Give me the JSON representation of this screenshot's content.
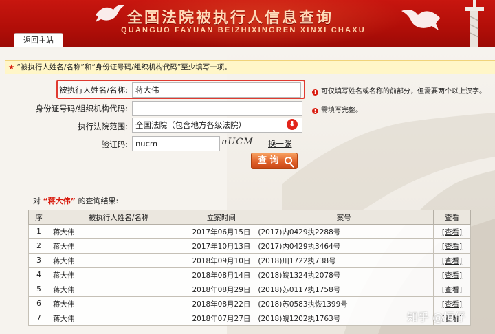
{
  "header": {
    "title_cn": "全国法院被执行人信息查询",
    "title_en": "QUANGUO FAYUAN BEIZHIXINGREN XINXI CHAXU",
    "home_tab_label": "返回主站"
  },
  "notice": {
    "text": "“被执行人姓名/名称”和“身份证号码/组织机构代码”至少填写一项。"
  },
  "form": {
    "name_label": "被执行人姓名/名称:",
    "name_value": "蒋大伟",
    "name_hint": "可仅填写姓名或名称的前部分，但需要两个以上汉字。",
    "id_label": "身份证号码/组织机构代码:",
    "id_value": "",
    "id_hint": "需填写完整。",
    "court_label": "执行法院范围:",
    "court_value": "全国法院（包含地方各级法院）",
    "captcha_label": "验证码:",
    "captcha_value": "nucm",
    "captcha_image_text": "nUCM",
    "refresh_label": "换一张",
    "query_label": "查 询"
  },
  "results": {
    "caption_prefix": "对",
    "caption_name": "“蒋大伟”",
    "caption_suffix": "的查询结果:",
    "columns": [
      "序",
      "被执行人姓名/名称",
      "立案时间",
      "案号",
      "查看"
    ],
    "rows": [
      {
        "no": "1",
        "name": "蒋大伟",
        "date": "2017年06月15日",
        "case": "(2017)内0429执2288号",
        "view": "[查看]"
      },
      {
        "no": "2",
        "name": "蒋大伟",
        "date": "2017年10月13日",
        "case": "(2017)内0429执3464号",
        "view": "[查看]"
      },
      {
        "no": "3",
        "name": "蒋大伟",
        "date": "2018年09月10日",
        "case": "(2018)川1722执738号",
        "view": "[查看]"
      },
      {
        "no": "4",
        "name": "蒋大伟",
        "date": "2018年08月14日",
        "case": "(2018)皖1324执2078号",
        "view": "[查看]"
      },
      {
        "no": "5",
        "name": "蒋大伟",
        "date": "2018年08月29日",
        "case": "(2018)苏0117执1758号",
        "view": "[查看]"
      },
      {
        "no": "6",
        "name": "蒋大伟",
        "date": "2018年08月22日",
        "case": "(2018)苏0583执恢1399号",
        "view": "[查看]"
      },
      {
        "no": "7",
        "name": "蒋大伟",
        "date": "2018年07月27日",
        "case": "(2018)皖1202执1763号",
        "view": "[查看]"
      }
    ]
  },
  "watermark": "知乎 @恒仔",
  "colors": {
    "header_red": "#c8160f",
    "accent_red": "#d91c0f",
    "notice_bg": "#fff6c8",
    "button_orange": "#e0622a"
  },
  "icons": {
    "hint": "exclamation-icon",
    "select": "dropdown-arrow-icon",
    "query": "magnifier-icon"
  }
}
